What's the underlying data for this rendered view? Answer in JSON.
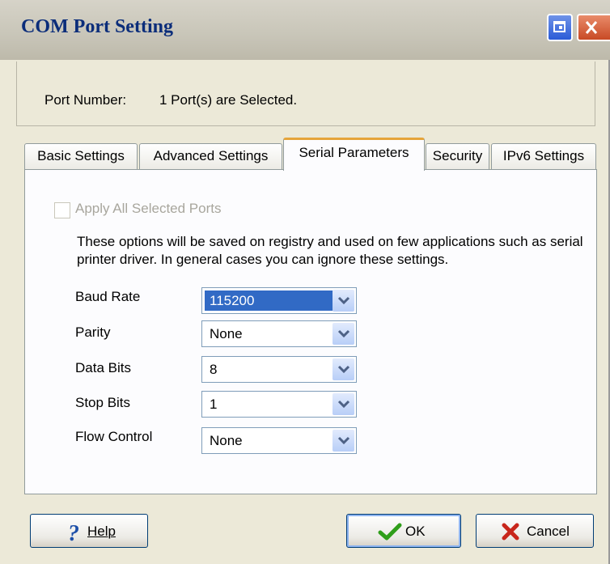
{
  "window": {
    "title": "COM Port Setting"
  },
  "port": {
    "label": "Port Number:",
    "value": "1 Port(s) are Selected."
  },
  "tabs": [
    {
      "label": "Basic Settings"
    },
    {
      "label": "Advanced Settings"
    },
    {
      "label": "Serial Parameters"
    },
    {
      "label": "Security"
    },
    {
      "label": "IPv6 Settings"
    }
  ],
  "active_tab": "Serial Parameters",
  "apply_all": {
    "label": "Apply All Selected Ports",
    "checked": false,
    "enabled": false
  },
  "description": "These options will be saved on registry and used on few applications such as serial printer driver. In general cases you can ignore these settings.",
  "fields": [
    {
      "label": "Baud Rate",
      "value": "115200"
    },
    {
      "label": "Parity",
      "value": "None"
    },
    {
      "label": "Data Bits",
      "value": "8"
    },
    {
      "label": "Stop Bits",
      "value": "1"
    },
    {
      "label": "Flow Control",
      "value": "None"
    }
  ],
  "buttons": {
    "help": "Help",
    "ok": "OK",
    "cancel": "Cancel"
  },
  "icons": {
    "help": "question-mark-icon",
    "ok": "checkmark-icon",
    "cancel": "x-icon"
  },
  "colors": {
    "accent": "#316ac5",
    "title": "#0b2d7a",
    "active_tab": "#e5a43a"
  }
}
